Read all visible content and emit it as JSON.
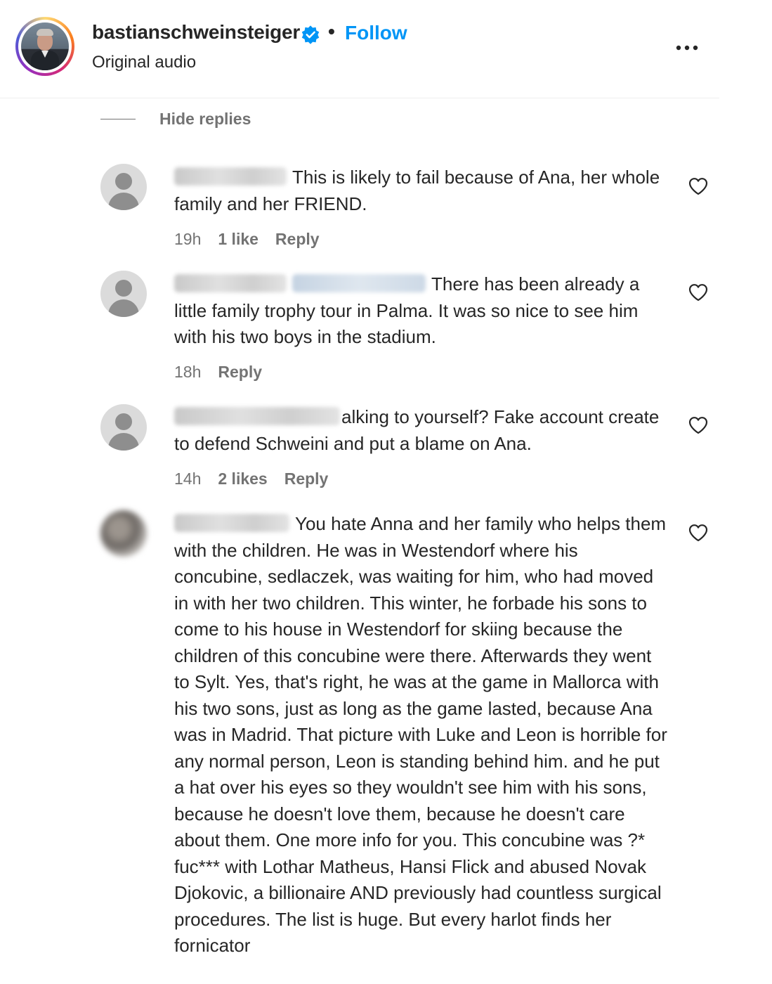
{
  "header": {
    "username": "bastianschweinsteiger",
    "separator": "•",
    "follow_label": "Follow",
    "subtitle": "Original audio",
    "verified_color": "#0095f6"
  },
  "thread": {
    "hide_replies_label": "Hide replies"
  },
  "comments": [
    {
      "text": "This is likely to fail because of Ana, her whole family and her FRIEND.",
      "time": "19h",
      "likes": "1 like",
      "reply_label": "Reply"
    },
    {
      "text": "There has been already a little family trophy tour in Palma. It was so nice to see him with his two boys in the stadium.",
      "time": "18h",
      "reply_label": "Reply"
    },
    {
      "text": "alking to yourself? Fake account create to defend Schweini and put a blame on Ana.",
      "time": "14h",
      "likes": "2 likes",
      "reply_label": "Reply"
    },
    {
      "text": "You hate Anna and her family who helps them with the children. He was in Westendorf where his concubine, sedlaczek, was waiting for him, who had moved in with her two children. This winter, he forbade his sons to come to his house in Westendorf for skiing because the children of this concubine were there. Afterwards they went to Sylt. Yes, that's right, he was at the game in Mallorca with his two sons, just as long as the game lasted, because Ana was in Madrid. That picture with Luke and Leon is horrible for any normal person, Leon is standing behind him. and he put a hat over his eyes so they wouldn't see him with his sons, because he doesn't love them, because he doesn't care about them. One more info for you. This concubine was ?* fuc*** with Lothar Matheus, Hansi Flick and abused Novak Djokovic, a billionaire AND previously had countless surgical procedures. The list is huge. But every harlot finds her fornicator"
    }
  ],
  "icons": {
    "more": "more-options-icon",
    "heart": "heart-icon",
    "verified": "verified-badge-icon",
    "default_avatar": "default-avatar-icon"
  }
}
